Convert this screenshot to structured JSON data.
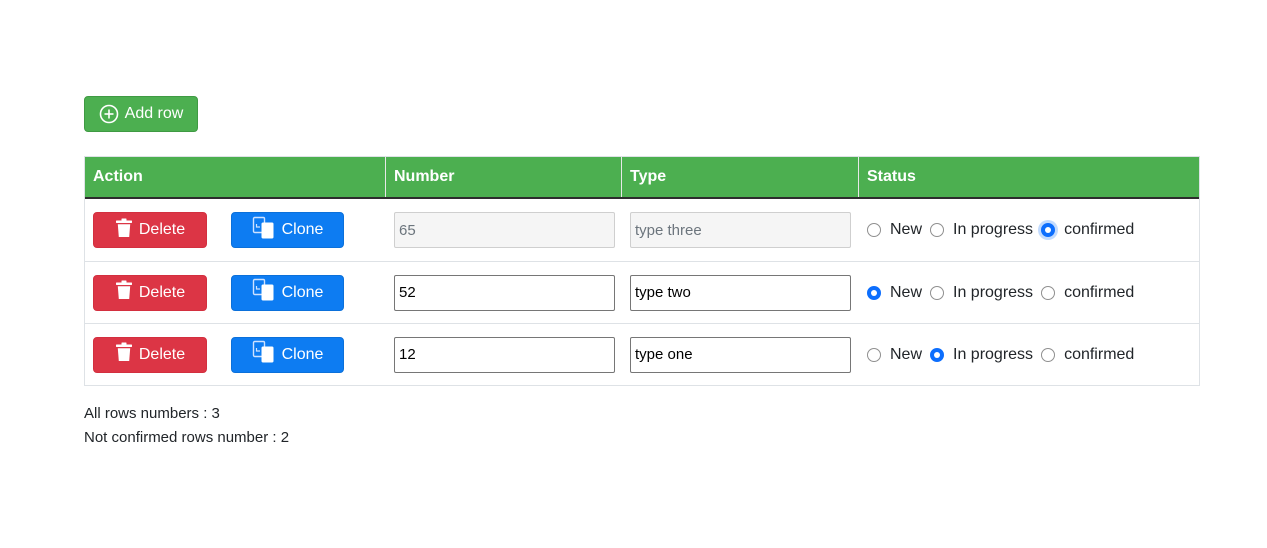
{
  "toolbar": {
    "add_row_label": "Add row"
  },
  "table": {
    "headers": {
      "action": "Action",
      "number": "Number",
      "type": "Type",
      "status": "Status"
    },
    "delete_label": "Delete",
    "clone_label": "Clone",
    "status_options": [
      "New",
      "In progress",
      "confirmed"
    ],
    "rows": [
      {
        "number": "65",
        "type": "type three",
        "status": "confirmed",
        "disabled": true
      },
      {
        "number": "52",
        "type": "type two",
        "status": "New",
        "disabled": false
      },
      {
        "number": "12",
        "type": "type one",
        "status": "In progress",
        "disabled": false
      }
    ]
  },
  "summary": {
    "all_rows": "All rows numbers : 3",
    "not_confirmed": "Not confirmed rows number : 2"
  },
  "colors": {
    "header_green": "#4caf50",
    "delete_red": "#dc3545",
    "clone_blue": "#0d7cf2",
    "radio_blue": "#0d6efd"
  },
  "icons": {
    "add": "plus-circle-icon",
    "delete": "trash-icon",
    "clone": "copy-icon"
  }
}
